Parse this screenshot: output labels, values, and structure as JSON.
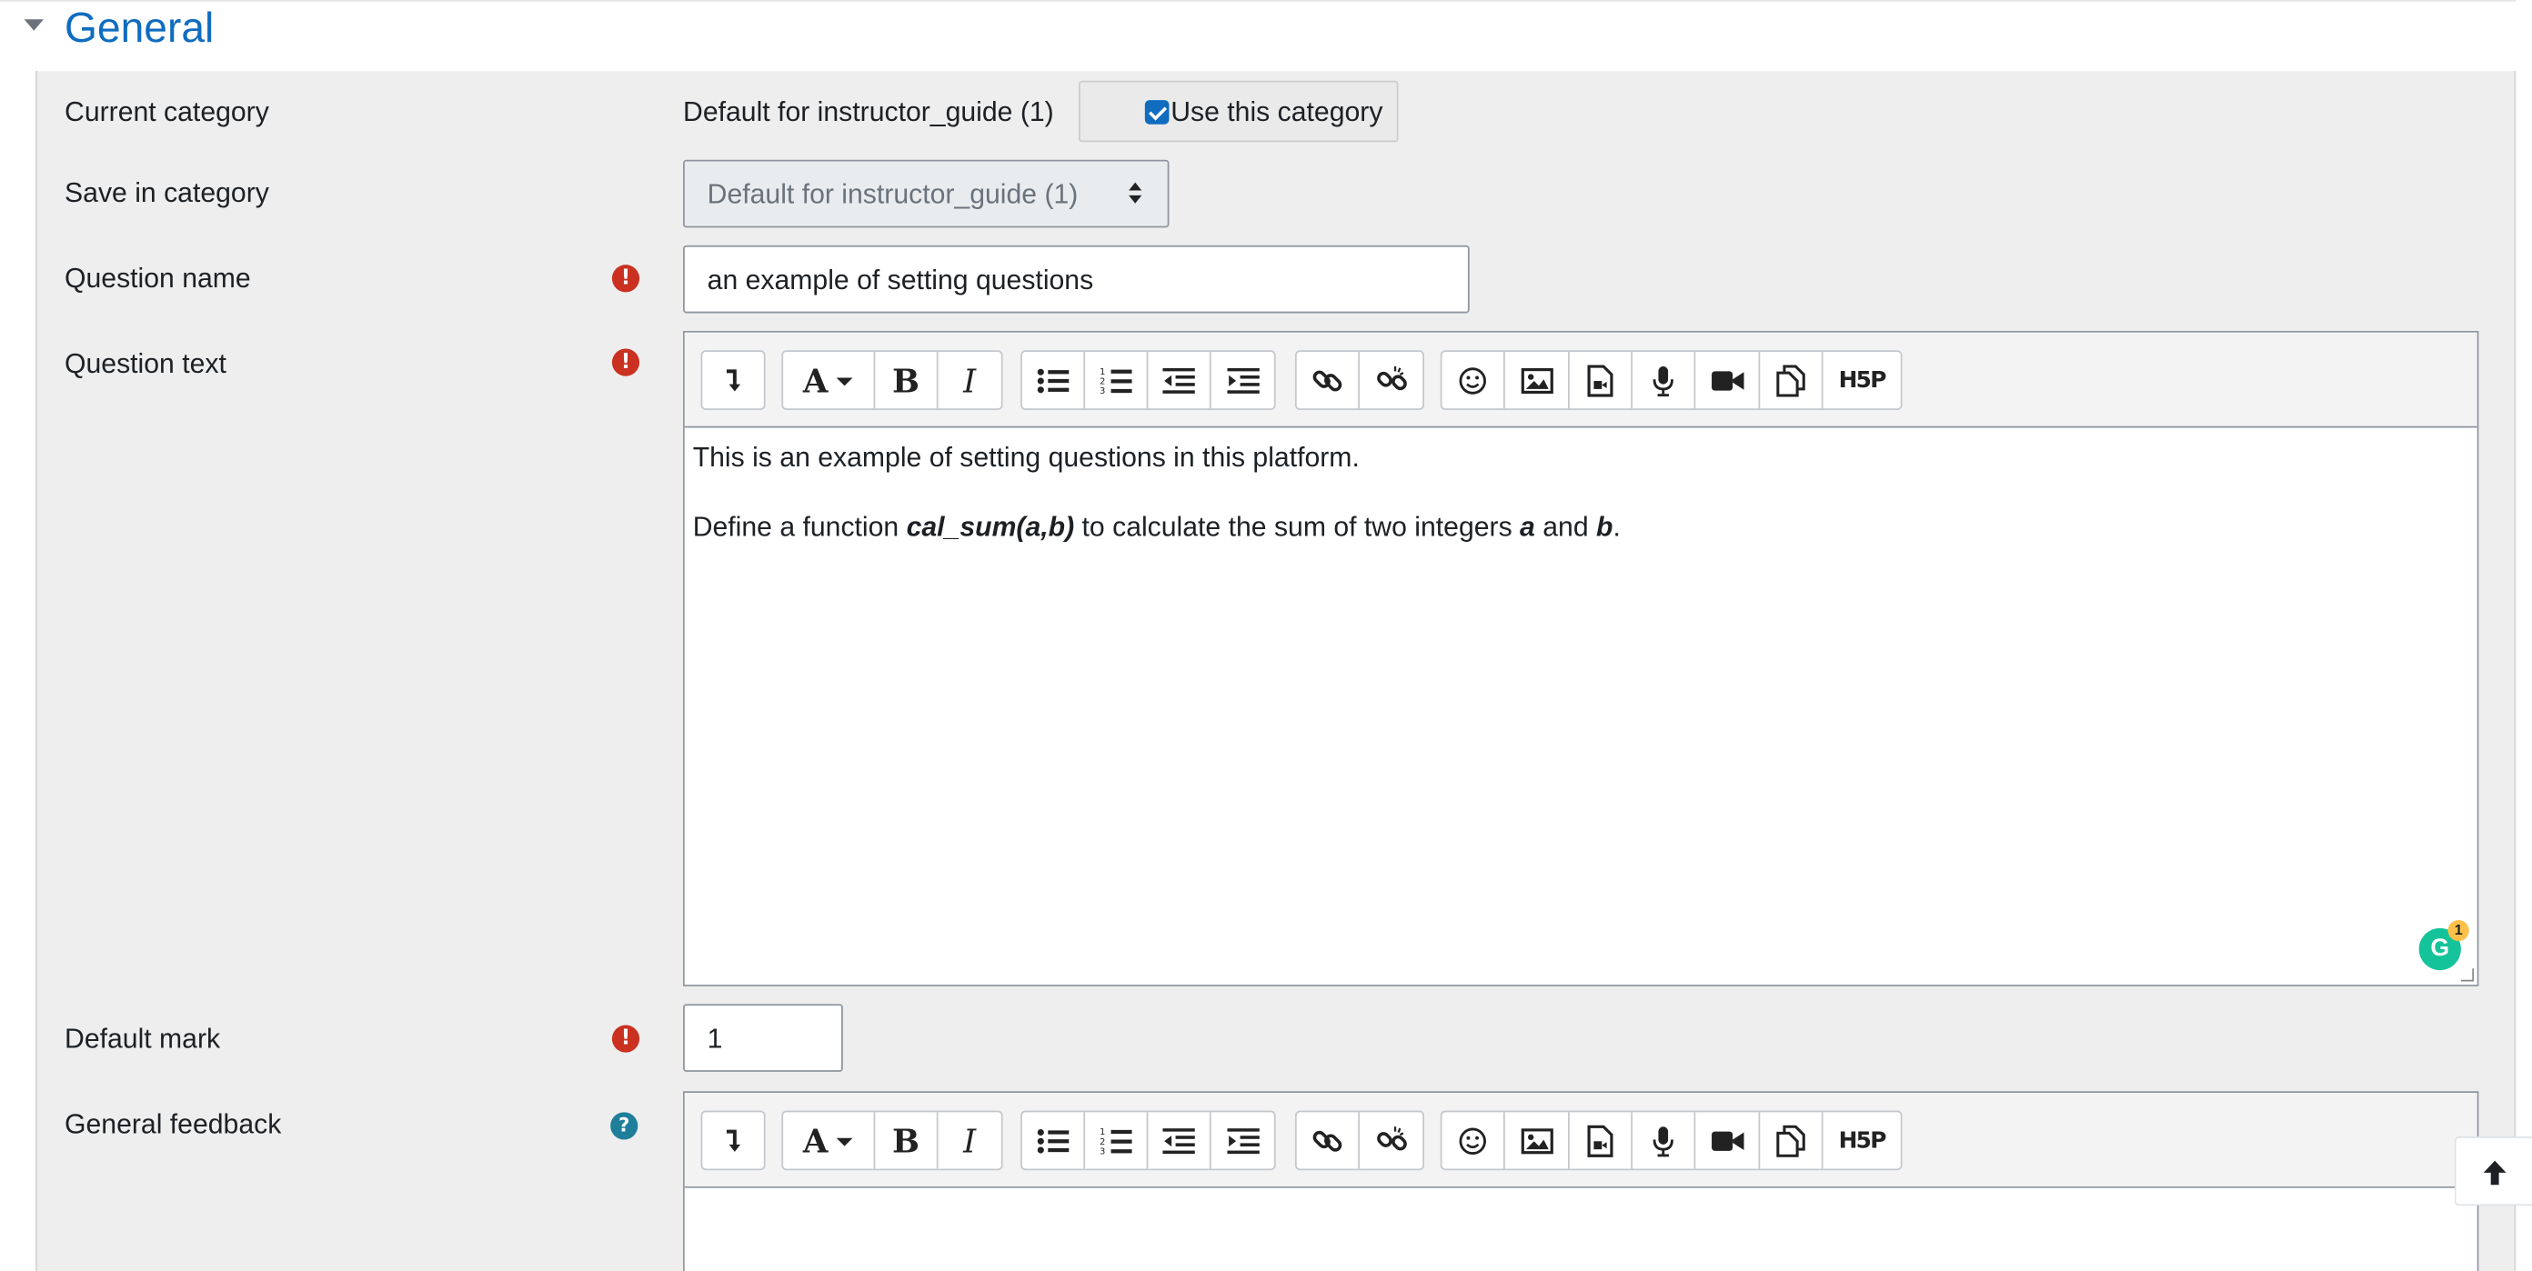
{
  "section": {
    "title": "General"
  },
  "fields": {
    "current_category": {
      "label": "Current category",
      "value": "Default for instructor_guide (1)",
      "checkbox_label": "Use this category",
      "checked": true
    },
    "save_in_category": {
      "label": "Save in category",
      "selected": "Default for instructor_guide (1)"
    },
    "question_name": {
      "label": "Question name",
      "value": "an example of setting questions",
      "required": true
    },
    "question_text": {
      "label": "Question text",
      "required": true,
      "line1": "This is an example of setting questions in this platform.",
      "line2_before": "Define a function ",
      "line2_code": "cal_sum(a,b)",
      "line2_mid": " to calculate the sum of two integers ",
      "line2_a": "a",
      "line2_and": " and ",
      "line2_b": "b",
      "line2_end": "."
    },
    "default_mark": {
      "label": "Default mark",
      "value": "1",
      "required": true
    },
    "general_feedback": {
      "label": "General feedback",
      "help": true
    }
  },
  "toolbar": {
    "font_label": "A",
    "bold_label": "B",
    "italic_label": "I",
    "h5p_label": "H5P",
    "icons": [
      "show-more-icon",
      "font-style-icon",
      "bold-icon",
      "italic-icon",
      "unordered-list-icon",
      "ordered-list-icon",
      "outdent-icon",
      "indent-icon",
      "link-icon",
      "unlink-icon",
      "emoji-icon",
      "image-icon",
      "media-icon",
      "record-audio-icon",
      "record-video-icon",
      "manage-files-icon",
      "h5p-icon"
    ]
  },
  "grammarly": {
    "letter": "G",
    "count": "1"
  },
  "colors": {
    "accent": "#0f6cbf",
    "required": "#ca3120",
    "help": "#1f7e9a",
    "panel": "#eeeeee"
  }
}
